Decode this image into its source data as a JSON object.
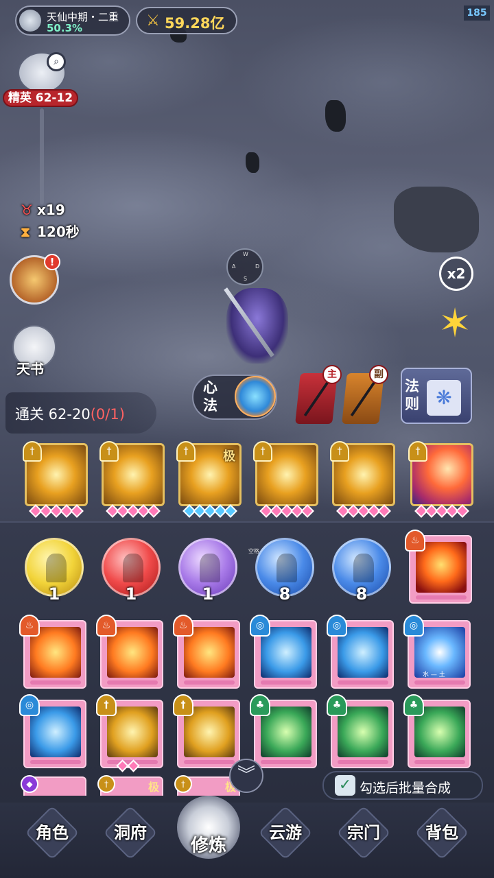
{
  "hud": {
    "realm": "天仙中期・二重",
    "realm_progress": "50.3%",
    "power": "59.28亿",
    "fps": "185"
  },
  "stage": {
    "label": "精英 62-12",
    "kills": "x19",
    "timer": "120秒"
  },
  "side_buttons": {
    "alert": "!",
    "tianshu": "天书"
  },
  "quest": {
    "label": "通关 62-20",
    "progress": "(0/1)"
  },
  "right_controls": {
    "speed": "x2"
  },
  "joystick": {
    "n": "W",
    "w": "A",
    "e": "D",
    "s": "S"
  },
  "skill_panel": {
    "xinfa": "心法",
    "main_weapon_badge": "主",
    "sub_weapon_badge": "副",
    "fa_ze": "法则"
  },
  "skills": [
    {
      "tag": ""
    },
    {
      "tag": ""
    },
    {
      "tag": "极"
    },
    {
      "tag": ""
    },
    {
      "tag": ""
    },
    {
      "tag": ""
    }
  ],
  "orbs": [
    {
      "count": "1",
      "color": "#f2d43a"
    },
    {
      "count": "1",
      "color": "#f04a4a"
    },
    {
      "count": "1",
      "color": "#a87ae8"
    },
    {
      "count": "8",
      "color": "#4a8ae8"
    },
    {
      "count": "8",
      "color": "#4a8ae8"
    }
  ],
  "orb_tag": "空格",
  "card_elements": "水 — 土",
  "batch": {
    "label": "勾选后批量合成",
    "check": "✓"
  },
  "nav": {
    "role": "角色",
    "cave": "洞府",
    "cultivate": "修炼",
    "travel": "云游",
    "sect": "宗门",
    "bag": "背包"
  }
}
